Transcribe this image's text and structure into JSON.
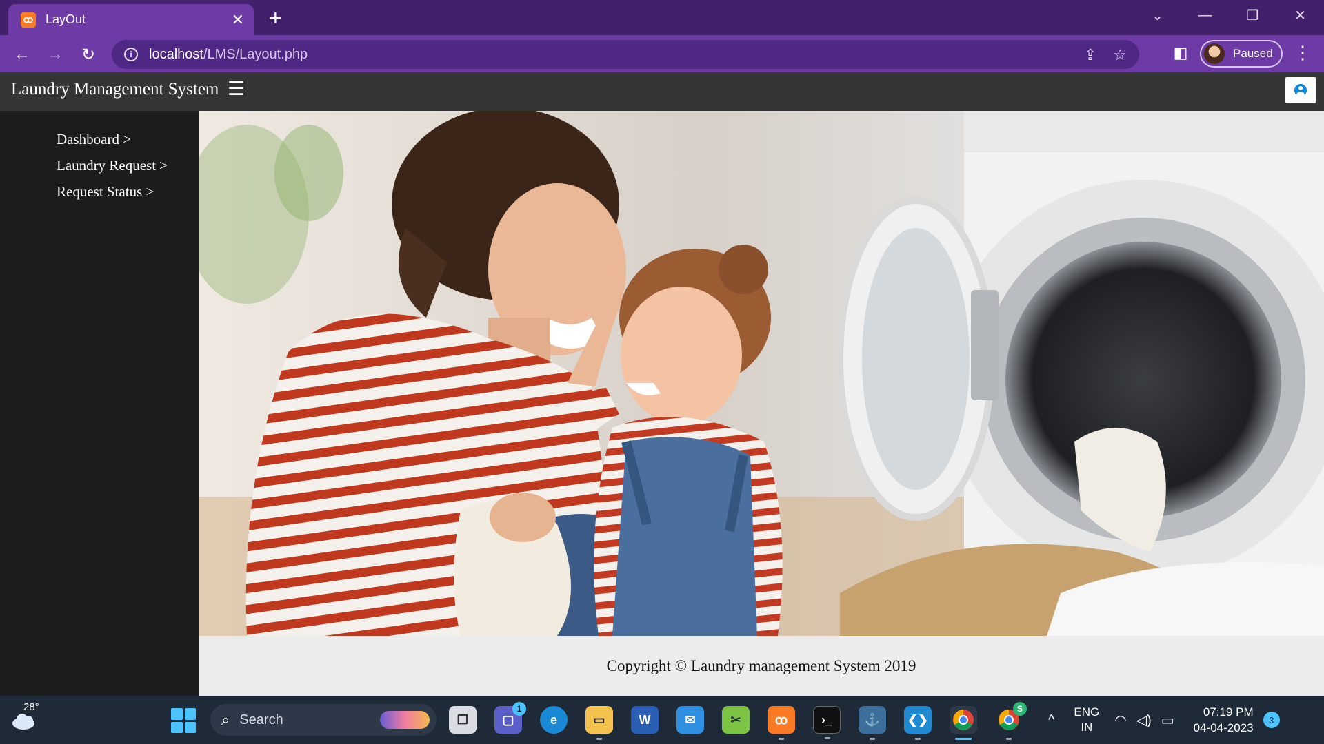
{
  "browser": {
    "tab_title": "LayOut",
    "tab_favicon": "xampp-icon",
    "url_host": "localhost",
    "url_path": "/LMS/Layout.php",
    "profile_label": "Paused",
    "new_tab_label": "+",
    "close_tab_label": "✕"
  },
  "app": {
    "brand": "Laundry Management System",
    "menu_icon": "☰",
    "sidebar": {
      "items": [
        {
          "label": "Dashboard >"
        },
        {
          "label": "Laundry Request >"
        },
        {
          "label": "Request Status >"
        }
      ]
    },
    "hero_image": "photo-mother-daughter-washing-machine",
    "footer": "Copyright © Laundry management System 2019"
  },
  "taskbar": {
    "weather_temp": "28°",
    "search_placeholder": "Search",
    "teams_badge": "1",
    "chrome_profile_badge": "S",
    "language": "ENG",
    "region": "IN",
    "time": "07:19 PM",
    "date": "04-04-2023",
    "notification_count": "3"
  },
  "colors": {
    "tab_strip": "#43206c",
    "toolbar": "#6d3aa6",
    "omnibox": "#4f2784",
    "app_header": "#353535",
    "sidebar": "#1c1c1c",
    "taskbar": "#1f2a38",
    "accent": "#4cc2ff"
  }
}
